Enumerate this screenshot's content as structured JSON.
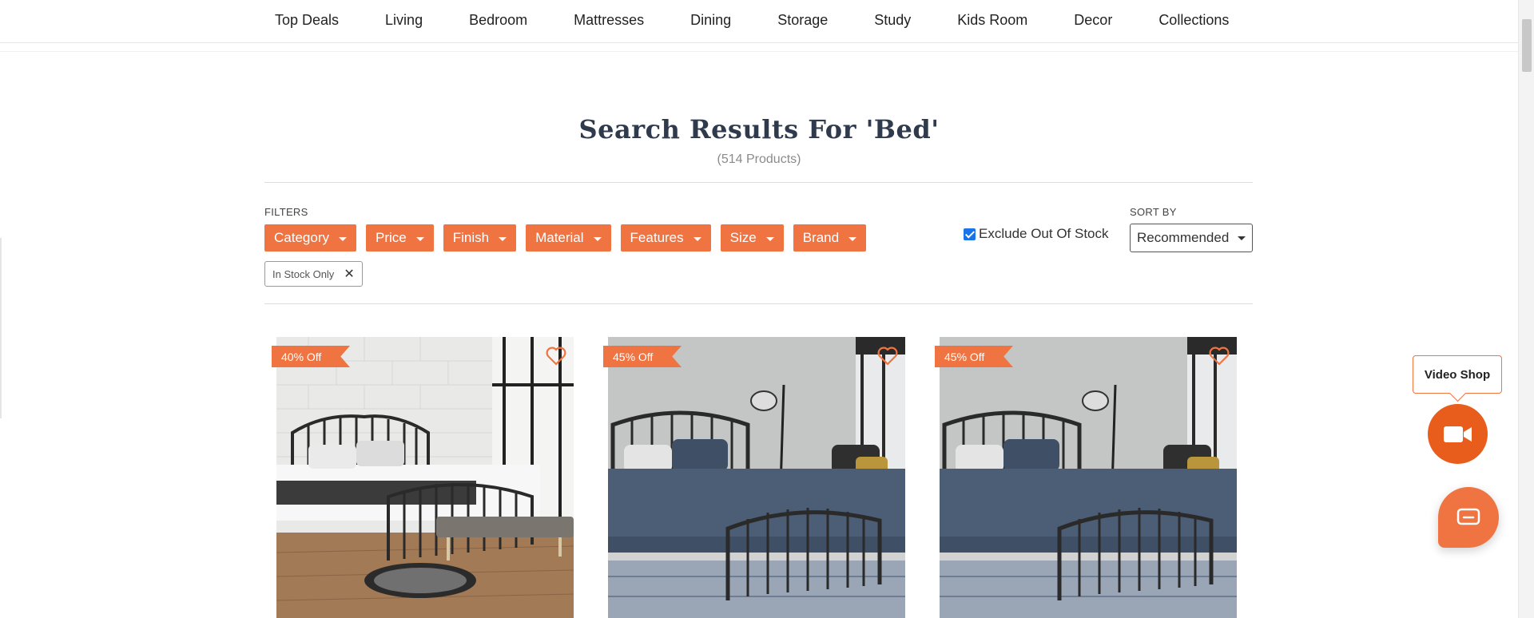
{
  "nav": {
    "items": [
      "Top Deals",
      "Living",
      "Bedroom",
      "Mattresses",
      "Dining",
      "Storage",
      "Study",
      "Kids Room",
      "Decor",
      "Collections"
    ]
  },
  "search": {
    "title": "Search Results For 'Bed'",
    "count_text": "(514 Products)"
  },
  "filters": {
    "label": "FILTERS",
    "buttons": [
      "Category",
      "Price",
      "Finish",
      "Material",
      "Features",
      "Size",
      "Brand"
    ],
    "active_chip": "In Stock Only",
    "exclude_out_of_stock_label": "Exclude Out Of Stock",
    "exclude_out_of_stock_checked": true
  },
  "sort": {
    "label": "SORT BY",
    "selected": "Recommended"
  },
  "products": [
    {
      "discount": "40% Off",
      "image": "metal-bed-spindle-headboard-brick-wall"
    },
    {
      "discount": "45% Off",
      "image": "metal-bed-arched-headboard-blue-bedding"
    },
    {
      "discount": "45% Off",
      "image": "metal-bed-arched-headboard-blue-bedding"
    }
  ],
  "widgets": {
    "video_shop_label": "Video Shop"
  },
  "colors": {
    "accent": "#ef7442",
    "video_button": "#e85c1c",
    "title": "#2f3b4c",
    "checkbox": "#1a73e8"
  }
}
